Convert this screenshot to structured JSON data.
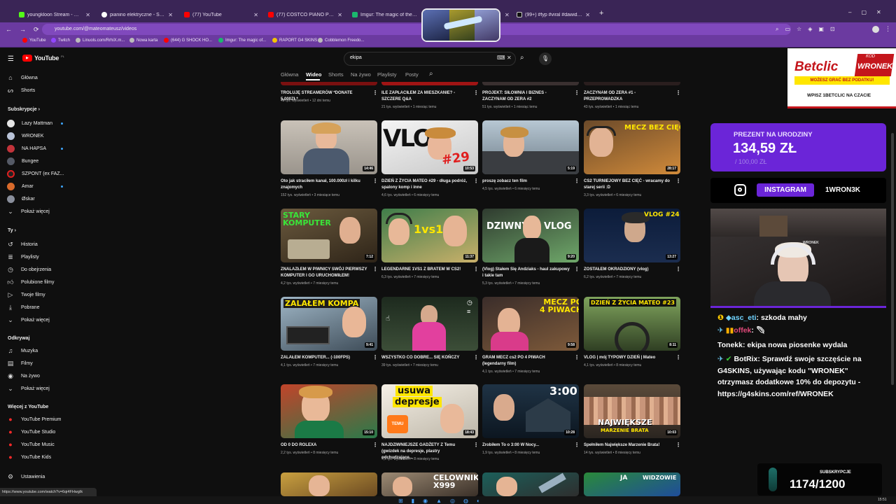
{
  "browser": {
    "tabs": [
      {
        "title": "youngkloon Stream - Watch Liv",
        "color": "#53fc18"
      },
      {
        "title": "pianino elektryczne - Szukaj w",
        "color": "#ffffff"
      },
      {
        "title": "(77) YouTube",
        "color": "#ff0000"
      },
      {
        "title": "(77) COSTCO PIANO PERFORMA",
        "color": "#ff0000"
      },
      {
        "title": "Imgur: The magic of the Interne",
        "color": "#1bb76e"
      },
      {
        "title": "(99+) #fyp #viral #dawidjasper",
        "color": "#000000"
      }
    ],
    "new_tab": "+",
    "url": "youtube.com/@mateomateusz/videos",
    "bookmarks": [
      "YouTube",
      "Twitch",
      "Linuols.com/RrhiX.m...",
      "Nowa karta",
      "(644) G SHOCK HO...",
      "Imgur: The magic of...",
      "RAPORT G4 SKINS",
      "Cobblemon Freedo..."
    ]
  },
  "youtube": {
    "logo": "YouTube",
    "logo_country": "PL",
    "search_query": "ekipa",
    "nav": {
      "home": "Główna",
      "shorts": "Shorts"
    },
    "subs_heading": "Subskrypcje",
    "subscriptions": [
      "Lazy Mattman",
      "WRONEK",
      "NA HAPSA",
      "Bungee",
      "SZPONT (ex FAZ...",
      "Amar",
      "Øskar"
    ],
    "show_more": "Pokaż więcej",
    "you_heading": "Ty",
    "you_items": [
      "Historia",
      "Playlisty",
      "Do obejrzenia",
      "Polubione filmy",
      "Twoje filmy",
      "Pobrane",
      "Pokaż więcej"
    ],
    "explore_heading": "Odkrywaj",
    "explore_items": [
      "Muzyka",
      "Filmy",
      "Na żywo",
      "Pokaż więcej"
    ],
    "more_heading": "Więcej z YouTube",
    "more_items": [
      "YouTube Premium",
      "YouTube Studio",
      "YouTube Music",
      "YouTube Kids"
    ],
    "settings": "Ustawienia",
    "channel_tabs": [
      "Główna",
      "Wideo",
      "Shorts",
      "Na żywo",
      "Playlisty",
      "Posty"
    ],
    "videos": [
      {
        "title": "TROLUJĘ STREAMERÓW *DONATE 5,000ZŁ*",
        "meta": "49 tys. wyświetleń • 12 dni temu"
      },
      {
        "title": "ILE ZAPŁACIŁEM ZA MIESZKANIE? - SZCZERE Q&A",
        "meta": "21 tys. wyświetleń • 1 miesiąc temu"
      },
      {
        "title": "PROJEKT: SIŁOWNIA I BIZNES - ZACZYNAM OD ZERA #2",
        "meta": "51 tys. wyświetleń • 1 miesiąc temu"
      },
      {
        "title": "ZACZYNAM OD ZERA #1 - PRZEPROWADZKA",
        "meta": "43 tys. wyświetleń • 1 miesiąc temu"
      },
      {
        "title": "Oto jak straciłem kanał, 100.000zł i kilku znajomych",
        "meta": "152 tys. wyświetleń • 3 miesiące temu",
        "duration": "14:46",
        "overlay": ""
      },
      {
        "title": "DZIEŃ Z ŻYCIA MATEO #29 - długa podróż, spalony komp i inne",
        "meta": "4,6 tys. wyświetleń • 6 miesięcy temu",
        "duration": "10:53",
        "overlay": "VLOG #29"
      },
      {
        "title": "proszę zobacz ten film",
        "meta": "4,5 tys. wyświetleń • 6 miesięcy temu",
        "duration": "5:19",
        "overlay": ""
      },
      {
        "title": "CS2 TURNIEJOWY BEZ CIĘĆ - wracamy do starej serii :D",
        "meta": "3,3 tys. wyświetleń • 6 miesięcy temu",
        "duration": "28:17",
        "overlay": "MECZ BEZ CIĘĆ"
      },
      {
        "title": "ZNALAZŁEM W PIWNICY SWÓJ PIERWSZY KOMPUTER I GO URUCHOMIŁEM!",
        "meta": "4,2 tys. wyświetleń • 7 miesięcy temu",
        "duration": "7:12",
        "overlay": "STARY KOMPUTER"
      },
      {
        "title": "LEGENDARNE 1VS1 Z BRATEM W CS2!",
        "meta": "6,3 tys. wyświetleń • 7 miesięcy temu",
        "duration": "11:37",
        "overlay": "1vs1"
      },
      {
        "title": "(Vlog) Stałem Się Andziaks - haul zakupowy i takie tam",
        "meta": "5,3 tys. wyświetleń • 7 miesięcy temu",
        "duration": "9:20",
        "overlay": "DZIWNY VLOG"
      },
      {
        "title": "ZOSTAŁEM OKRADZIONY (vlog)",
        "meta": "6,2 tys. wyświetleń • 7 miesięcy temu",
        "duration": "13:27",
        "overlay": "VLOG #24"
      },
      {
        "title": "ZALAŁEM KOMPUTER... (-100FPS)",
        "meta": "4,1 tys. wyświetleń • 7 miesięcy temu",
        "duration": "9:41",
        "overlay": "ZALAŁEM KOMPA"
      },
      {
        "title": "WSZYSTKO CO DOBRE... SIĘ KOŃCZY",
        "meta": "39 tys. wyświetleń • 7 miesięcy temu",
        "duration": "",
        "overlay": ""
      },
      {
        "title": "GRAM MECZ cs2 PO 4 PIWACH (legendarny film)",
        "meta": "4,1 tys. wyświetleń • 7 miesięcy temu",
        "duration": "9:58",
        "overlay": "MECZ PO 4 PIWACH"
      },
      {
        "title": "VLOG | mój TYPOWY DZIEŃ | Mateo",
        "meta": "4,1 tys. wyświetleń • 8 miesięcy temu",
        "duration": "8:11",
        "overlay": "DZIEŃ Z ŻYCIA MATEO #23"
      },
      {
        "title": "OD 0 DO ROLEXA",
        "meta": "2,2 tys. wyświetleń • 8 miesięcy temu",
        "duration": "15:10",
        "overlay": ""
      },
      {
        "title": "NAJDZIWNIEJSZE GADŻETY Z Temu (gwizdek na depresje, plastry odchudzające...",
        "meta": "4,9 tys. wyświetleń • 8 miesięcy temu",
        "duration": "18:43",
        "overlay": "usuwa depresje"
      },
      {
        "title": "Zrobiłem To o 3:00 W Nocy...",
        "meta": "1,9 tys. wyświetleń • 8 miesięcy temu",
        "duration": "10:28",
        "overlay": "3:00"
      },
      {
        "title": "Spełniłem Największe Marzenie Brata!",
        "meta": "14 tys. wyświetleń • 8 miesięcy temu",
        "duration": "10:03",
        "overlay": "NAJWIĘKSZE MARZENIE BRATA"
      }
    ],
    "bottom_overlays": [
      "",
      "CELOWNIK X999",
      "",
      "JA WIDZOWIE"
    ]
  },
  "stream_overlay": {
    "ad_brand": "Betclic",
    "ad_code_label": "KOD",
    "ad_code": "WRONEK",
    "ad_tagline": "MOŻESZ GRAĆ BEZ PODATKU!",
    "ad_footer": "WPISZ 1BETCLIC NA CZACIE",
    "goal_title": "PREZENT NA URODZINY",
    "goal_amount": "134,59 ZŁ",
    "goal_target": "/ 100,00 ZŁ",
    "instagram_label": "INSTAGRAM",
    "instagram_handle": "1WRON3K",
    "chat": [
      {
        "user": "asc_eti",
        "text": "szkoda mahy",
        "color": "#6fd3ff"
      },
      {
        "user": "offek",
        "text": "",
        "color": "#e0497a"
      },
      {
        "user": "Tonekk",
        "text": "ekipa nowa piosenke wydala",
        "color": "#ffffff"
      },
      {
        "user": "BotRix",
        "text": "Sprawdź swoje szczęście na G4SKINS, używając kodu \"WRONEK\" otrzymasz dodatkowe 10% do depozytu - https://g4skins.com/ref/WRONEK",
        "color": "#ffffff"
      }
    ],
    "subs_label": "SUBSKRYPCJE",
    "subs_count": "1174/1200"
  },
  "status_url": "https://www.youtube.com/watch?v=6qi4FHwgIk",
  "clock": "15:51"
}
